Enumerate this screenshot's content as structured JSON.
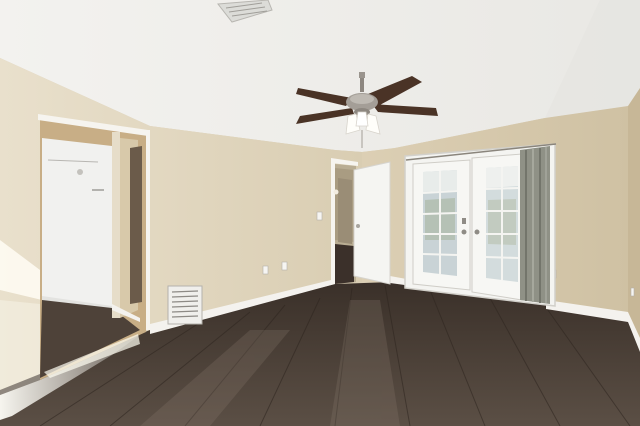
{
  "photo": {
    "subject": "empty-room",
    "colors": {
      "ceiling": "#f2f1ee",
      "wall": "#dfd3b9",
      "wall_shadow": "#cbbd9f",
      "floor_dark": "#3f342c",
      "floor_light": "#6e6257",
      "baseboard": "#f4f2ee",
      "door": "#f5f5f2",
      "curtain": "#8f9186",
      "fan_blade": "#4a3326",
      "fan_metal": "#9a948d",
      "glass": "#c9d3d6"
    },
    "icons": [
      "ceiling-fan-icon",
      "air-vent-icon",
      "light-switch-icon",
      "outlet-icon"
    ]
  }
}
